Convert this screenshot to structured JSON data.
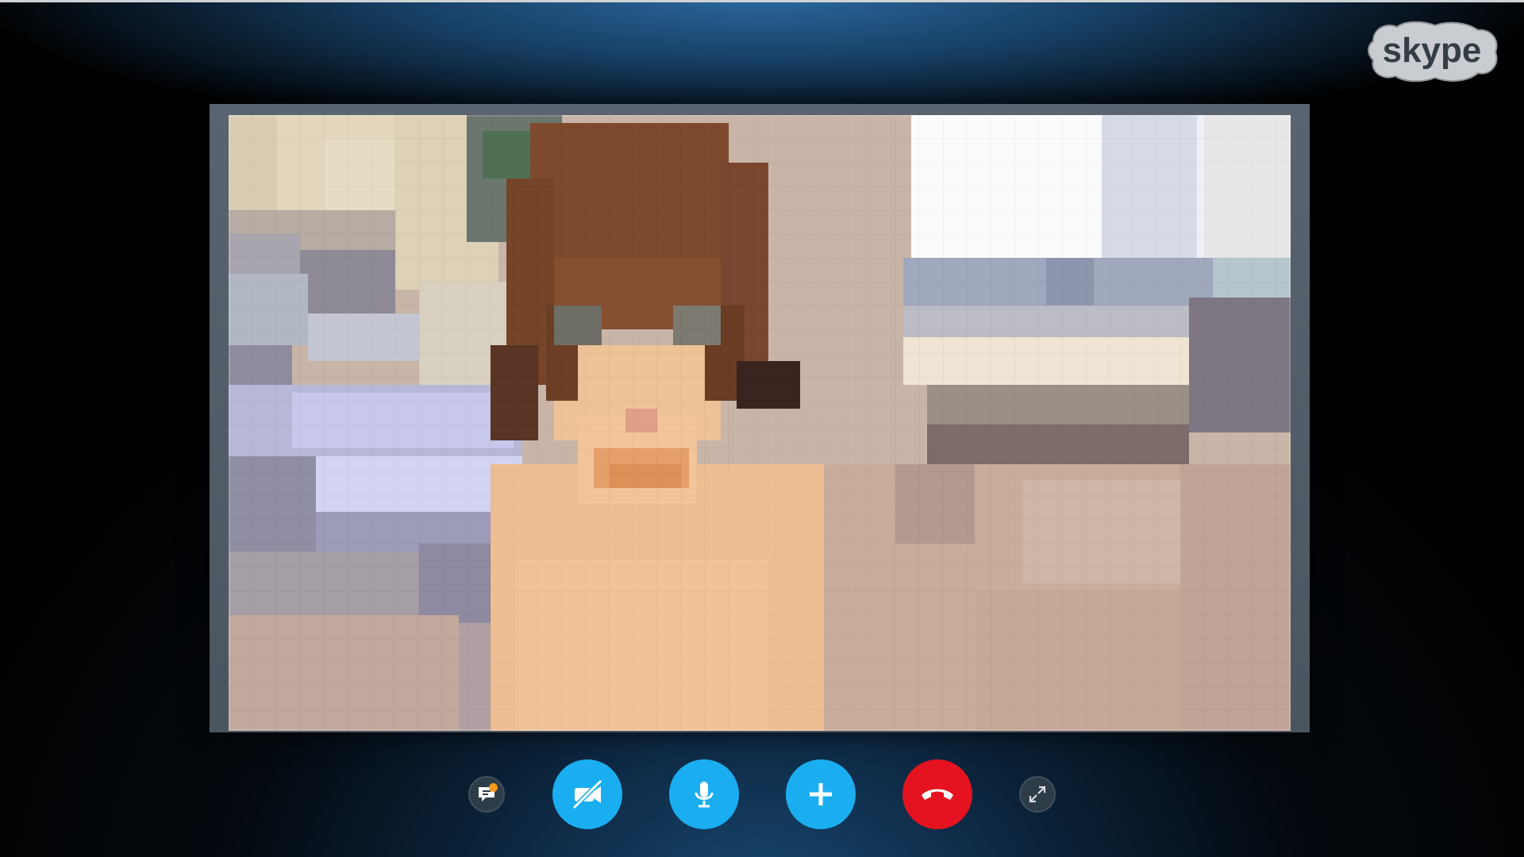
{
  "app": {
    "brand": "skype"
  },
  "call": {
    "video_feed": "remote-participant-video",
    "controls": [
      {
        "name": "chat",
        "icon": "chat-bubble-icon",
        "has_notification": true
      },
      {
        "name": "video",
        "icon": "video-camera-off-icon",
        "state": "off"
      },
      {
        "name": "microphone",
        "icon": "microphone-icon",
        "state": "on"
      },
      {
        "name": "add-participant",
        "icon": "plus-icon"
      },
      {
        "name": "end-call",
        "icon": "hang-up-phone-icon"
      },
      {
        "name": "fullscreen",
        "icon": "expand-arrows-icon"
      }
    ]
  },
  "colors": {
    "accent_blue": "#1aaef0",
    "end_call_red": "#e5131f",
    "notification_orange": "#f39a1e",
    "background_dark": "#04090f"
  }
}
